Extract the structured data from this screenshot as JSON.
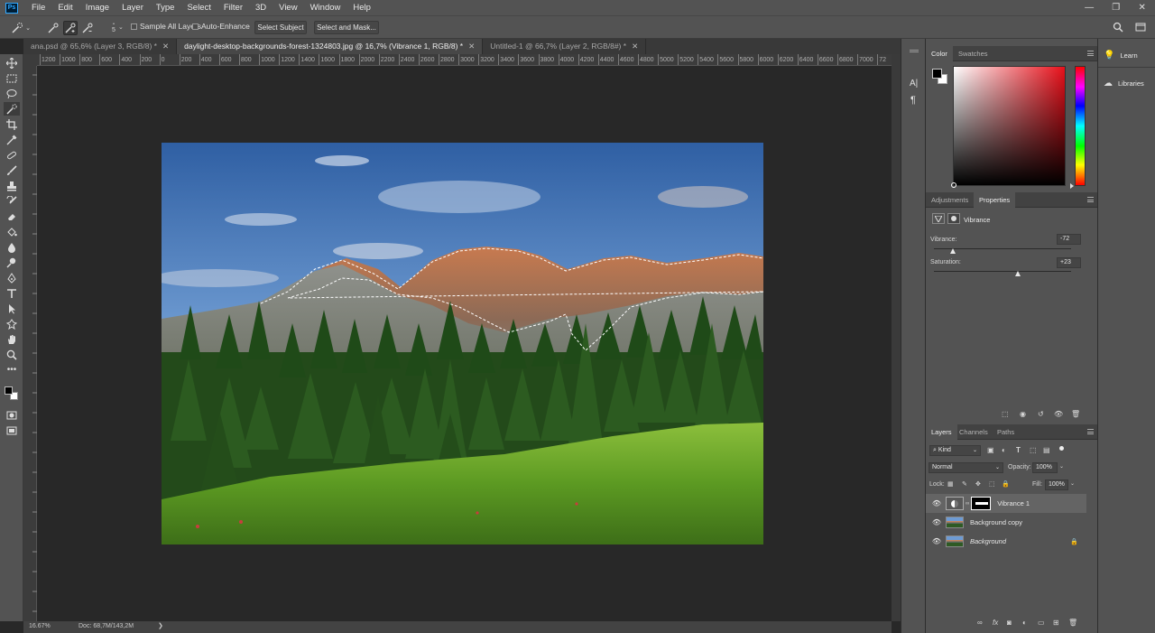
{
  "menubar": {
    "logo": "Ps",
    "items": [
      "File",
      "Edit",
      "Image",
      "Layer",
      "Type",
      "Select",
      "Filter",
      "3D",
      "View",
      "Window",
      "Help"
    ]
  },
  "options": {
    "brush_size": "5",
    "sample_all_layers": "Sample All Layers",
    "auto_enhance": "Auto-Enhance",
    "select_subject": "Select Subject",
    "select_and_mask": "Select and Mask..."
  },
  "tabs": [
    {
      "label": "ana.psd @ 65,6% (Layer 3, RGB/8) *",
      "active": false
    },
    {
      "label": "daylight-desktop-backgrounds-forest-1324803.jpg @ 16,7% (Vibrance 1, RGB/8) *",
      "active": true
    },
    {
      "label": "Untitled-1 @ 66,7% (Layer 2, RGB/8#) *",
      "active": false
    }
  ],
  "ruler": {
    "h_ticks": [
      "1200",
      "1000",
      "800",
      "600",
      "400",
      "200",
      "0",
      "200",
      "400",
      "600",
      "800",
      "1000",
      "1200",
      "1400",
      "1600",
      "1800",
      "2000",
      "2200",
      "2400",
      "2600",
      "2800",
      "3000",
      "3200",
      "3400",
      "3600",
      "3800",
      "4000",
      "4200",
      "4400",
      "4600",
      "4800",
      "5000",
      "5200",
      "5400",
      "5600",
      "5800",
      "6000",
      "6200",
      "6400",
      "6600",
      "6800",
      "7000",
      "72"
    ]
  },
  "status": {
    "zoom": "16.67%",
    "doc": "Doc: 68,7M/143,2M",
    "arrow": "❯"
  },
  "color_panel": {
    "tabs": [
      "Color",
      "Swatches"
    ],
    "foreground": "#000000",
    "background": "#ffffff",
    "hue_color": "#e8101a"
  },
  "properties_panel": {
    "tabs": [
      "Adjustments",
      "Properties"
    ],
    "title": "Vibrance",
    "vibrance_label": "Vibrance:",
    "vibrance_value": "-72",
    "vibrance_slider": -72,
    "saturation_label": "Saturation:",
    "saturation_value": "+23",
    "saturation_slider": 23
  },
  "layers_panel": {
    "tabs": [
      "Layers",
      "Channels",
      "Paths"
    ],
    "filter_kind": "Kind",
    "blend_mode": "Normal",
    "opacity_label": "Opacity:",
    "opacity_value": "100%",
    "lock_label": "Lock:",
    "fill_label": "Fill:",
    "fill_value": "100%",
    "layers": [
      {
        "name": "Vibrance 1",
        "selected": true
      },
      {
        "name": "Background copy",
        "selected": false
      },
      {
        "name": "Background",
        "selected": false
      }
    ]
  },
  "learn_panel": {
    "learn": "Learn",
    "libraries": "Libraries"
  },
  "midstrip": {
    "char_label": "A|",
    "para_label": "¶"
  }
}
